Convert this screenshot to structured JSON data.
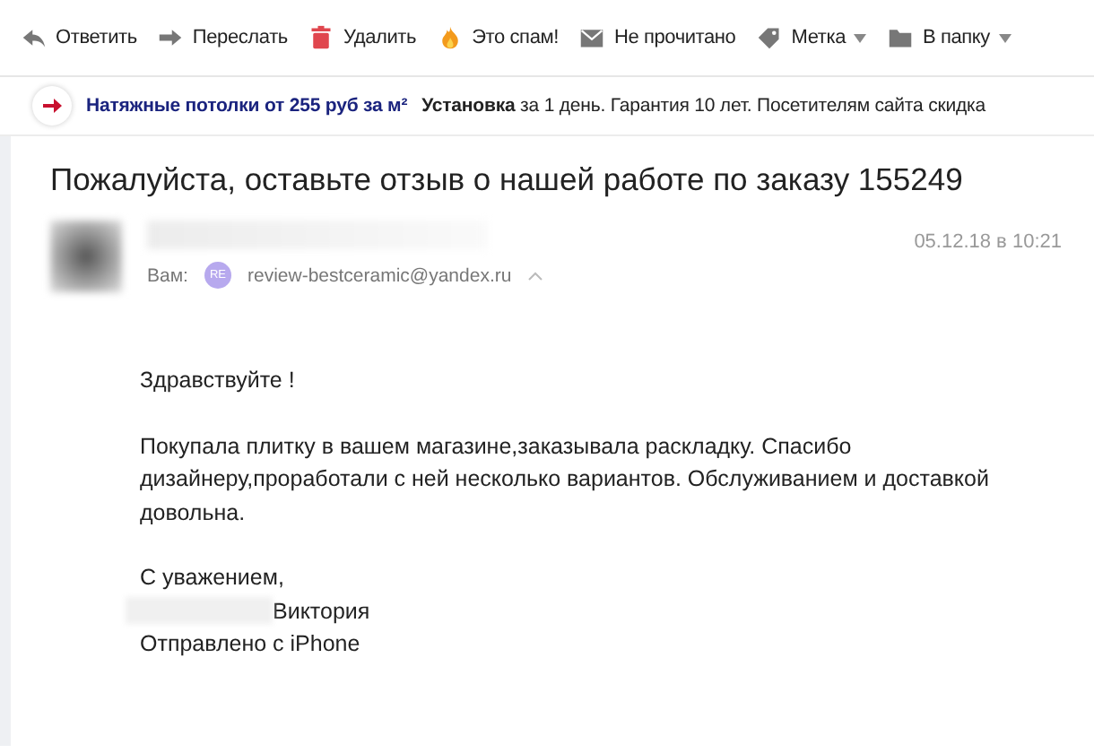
{
  "toolbar": [
    {
      "kind": "reply",
      "label": "Ответить",
      "dropdown": false
    },
    {
      "kind": "forward",
      "label": "Переслать",
      "dropdown": false
    },
    {
      "kind": "delete",
      "label": "Удалить",
      "dropdown": false
    },
    {
      "kind": "spam",
      "label": "Это спам!",
      "dropdown": false
    },
    {
      "kind": "unread",
      "label": "Не прочитано",
      "dropdown": false
    },
    {
      "kind": "label",
      "label": "Метка",
      "dropdown": true
    },
    {
      "kind": "folder",
      "label": "В папку",
      "dropdown": true
    }
  ],
  "ad": {
    "link": "Натяжные потолки от 255 руб за м²",
    "text": "**Установка** за 1 день. Гарантия 10 лет. Посетителям сайта скидка"
  },
  "message": {
    "subject": "Пожалуйста, оставьте отзыв о нашей работе по заказу 155249",
    "date": "05.12.18 в 10:21",
    "to_label": "Вам:",
    "to_badge": "RE",
    "to_address": "review-bestceramic@yandex.ru",
    "body": [
      {
        "kind": "text",
        "text": "Здравствуйте !"
      },
      {
        "kind": "text",
        "text": "Покупала плитку в вашем магазине,заказывала раскладку. Спасибо дизайнеру,проработали с ней несколько вариантов. Обслуживанием и доставкой довольна."
      },
      {
        "kind": "signature",
        "closing": "С уважением,",
        "name": "Виктория",
        "sent": "Отправлено с iPhone"
      }
    ]
  }
}
